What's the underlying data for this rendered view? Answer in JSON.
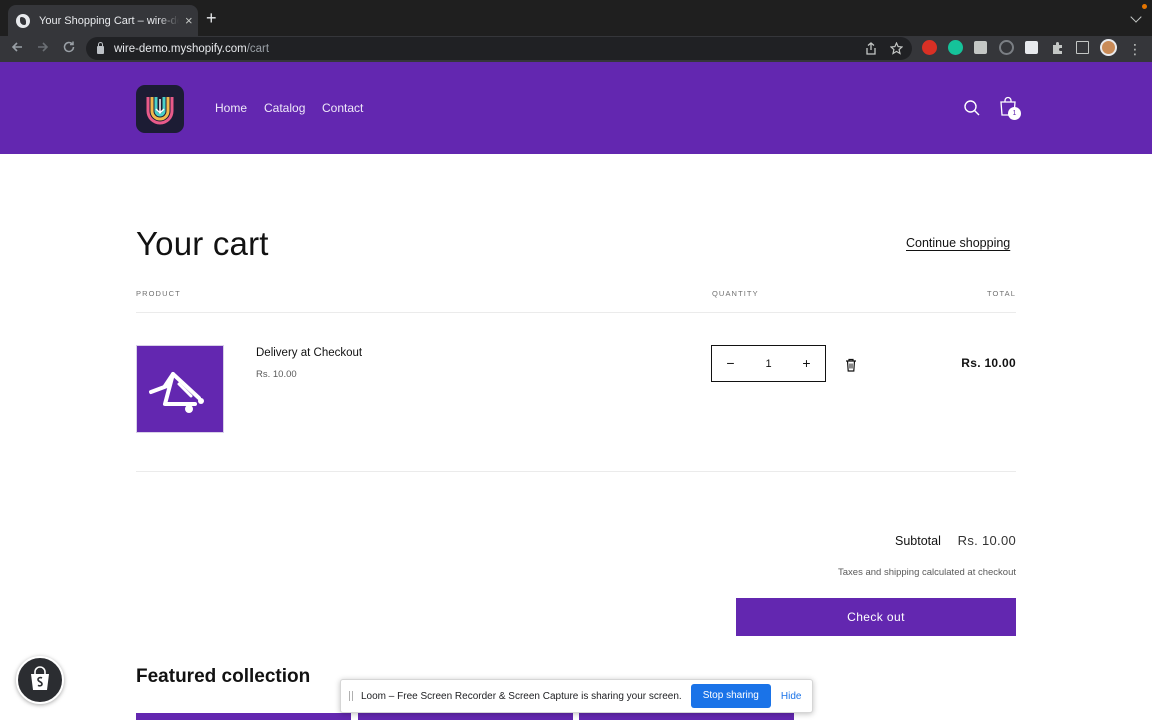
{
  "browser": {
    "tab_title": "Your Shopping Cart – wire-demo",
    "tab_close": "×",
    "new_tab": "+",
    "url_host": "wire-demo.myshopify.com",
    "url_path": "/cart",
    "nav_icons": [
      "back-arrow-icon",
      "forward-arrow-icon",
      "reload-icon"
    ],
    "extension_icons": [
      "red-extension-icon",
      "grammarly-icon",
      "screenshot-extension-icon",
      "history-extension-icon",
      "notion-icon",
      "puzzle-extensions-icon",
      "side-panel-icon",
      "profile-avatar-icon"
    ],
    "recording_indicator_color": "#e37400"
  },
  "header": {
    "brand_color": "#6327b0",
    "logo_icon": "store-logo-icon",
    "nav": [
      "Home",
      "Catalog",
      "Contact"
    ],
    "search_icon": "search-icon",
    "cart_icon": "shopping-bag-icon",
    "cart_count": "1"
  },
  "cart": {
    "title": "Your cart",
    "continue_link": "Continue shopping",
    "columns": {
      "product": "PRODUCT",
      "quantity": "QUANTITY",
      "total": "TOTAL"
    },
    "items": [
      {
        "name": "Delivery at Checkout",
        "price": "Rs. 10.00",
        "quantity": "1",
        "decrease": "−",
        "increase": "+",
        "line_total": "Rs. 10.00",
        "image_icon": "delivery-cart-icon",
        "remove_icon": "trash-icon"
      }
    ],
    "subtotal_label": "Subtotal",
    "subtotal_value": "Rs. 10.00",
    "tax_note": "Taxes and shipping calculated at checkout",
    "checkout_button": "Check out"
  },
  "featured": {
    "title": "Featured collection"
  },
  "shopify_badge_icon": "shopify-bag-icon",
  "loom": {
    "message": "Loom – Free Screen Recorder & Screen Capture is sharing your screen.",
    "stop_button": "Stop sharing",
    "hide_link": "Hide",
    "accent_color": "#1a73e8"
  }
}
